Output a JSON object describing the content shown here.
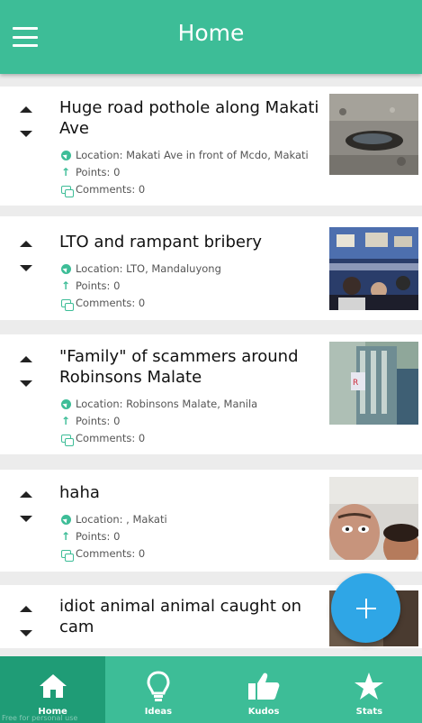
{
  "appbar": {
    "title": "Home",
    "menu_icon": "hamburger-menu-icon"
  },
  "posts": [
    {
      "title": "Huge road pothole along Makati Ave",
      "location": "Location: Makati Ave in front of Mcdo, Makati",
      "points": "Points: 0",
      "comments": "Comments: 0"
    },
    {
      "title": "LTO and rampant bribery",
      "location": "Location: LTO, Mandaluyong",
      "points": "Points: 0",
      "comments": "Comments: 0"
    },
    {
      "title": "\"Family\" of scammers around Robinsons Malate",
      "location": "Location: Robinsons Malate, Manila",
      "points": "Points: 0",
      "comments": "Comments: 0"
    },
    {
      "title": "haha",
      "location": "Location: , Makati",
      "points": "Points: 0",
      "comments": "Comments: 0"
    },
    {
      "title": "idiot animal animal caught on cam"
    }
  ],
  "nav": [
    {
      "label": "Home",
      "icon": "home-icon",
      "active": true
    },
    {
      "label": "Ideas",
      "icon": "lightbulb-icon"
    },
    {
      "label": "Kudos",
      "icon": "thumbs-up-icon"
    },
    {
      "label": "Stats",
      "icon": "star-icon"
    }
  ],
  "watermark": "Free for personal use",
  "colors": {
    "primary": "#3dbd97",
    "primary_dark": "#1f9c76",
    "fab": "#2fa6e6"
  }
}
